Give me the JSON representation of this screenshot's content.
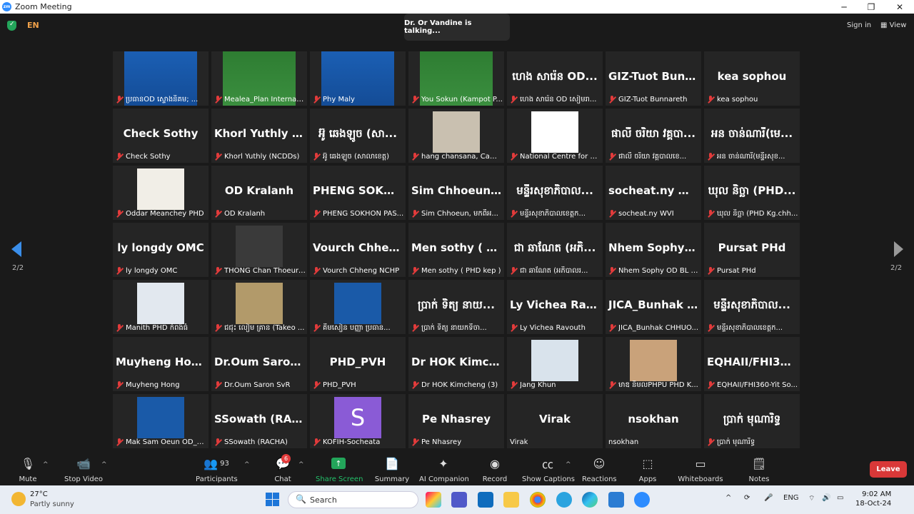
{
  "window": {
    "title": "Zoom Meeting",
    "minimize": "─",
    "maximize": "❐",
    "close": "✕"
  },
  "top": {
    "lang": "EN",
    "talking": "Dr. Or Vandine is talking...",
    "signin": "Sign in",
    "view": "View"
  },
  "pager": {
    "left": "2/2",
    "right": "2/2"
  },
  "tiles": [
    {
      "big": "",
      "label": "ប្រធានOD ស្ទោងនិគម; ..."
    },
    {
      "big": "",
      "label": "Mealea_Plan Internatio..."
    },
    {
      "big": "",
      "label": "Phy Maly"
    },
    {
      "big": "",
      "label": "You Sokun (Kampot P..."
    },
    {
      "big": "ហេង សារ៉េន OD...",
      "label": "ហេង សារ៉េន OD សៀមរា..."
    },
    {
      "big": "GIZ-Tuot Bunna...",
      "label": "GIZ-Tuot Bunnareth"
    },
    {
      "big": "kea sophou",
      "label": "kea sophou"
    },
    {
      "big": "Check Sothy",
      "label": "Check Sothy"
    },
    {
      "big": "Khorl Yuthly (N...",
      "label": "Khorl Yuthly (NCDDs)"
    },
    {
      "big": "អ៊ូ ឆេងឡូច (សា...",
      "label": "អ៊ូ ឆេងឡូច (សាលាខេត្ត)"
    },
    {
      "big": "",
      "label": "hang chansana, Camb..."
    },
    {
      "big": "",
      "label": "National Centre for Health..."
    },
    {
      "big": "ផាលី ចរិយា វគ្គបា...",
      "label": "ផាលី ចរិយា វគ្គបាលខេ..."
    },
    {
      "big": "អន ចាន់ណារី(មេ...",
      "label": "អន ចាន់ណារី(មន្ទីរសុខ..."
    },
    {
      "big": "",
      "label": "Oddar Meanchey PHD"
    },
    {
      "big": "OD Kralanh",
      "label": "OD Kralanh"
    },
    {
      "big": "PHENG SOKHO...",
      "label": "PHENG SOKHON PAS..."
    },
    {
      "big": "Sim Chhoeun, ម...",
      "label": "Sim Chhoeun, មកពីអ..."
    },
    {
      "big": "មន្ទីរសុខាភិបាល...",
      "label": "មន្ទីរសុខាភិបាលខេត្តក..."
    },
    {
      "big": "socheat.ny WVI",
      "label": "socheat.ny WVI"
    },
    {
      "big": "ឃុល និច្ឆា (PHD...",
      "label": "ឃុល និច្ឆា (PHD Kg.chh..."
    },
    {
      "big": "ly longdy    OMC",
      "label": "ly longdy    OMC"
    },
    {
      "big": "",
      "label": "THONG Chan Thoeurn..."
    },
    {
      "big": "Vourch Chheng...",
      "label": "Vourch Chheng NCHP"
    },
    {
      "big": "Men sothy ( PH...",
      "label": "Men sothy ( PHD kep )"
    },
    {
      "big": "ជា ឆាណែត (អភិ...",
      "label": "ជា ឆាណែត (អភិបាលរ..."
    },
    {
      "big": "Nhem Sophy O...",
      "label": "Nhem Sophy OD BL R..."
    },
    {
      "big": "Pursat PHd",
      "label": "Pursat PHd"
    },
    {
      "big": "",
      "label": "Manith PHD កំពង់ធំ"
    },
    {
      "big": "",
      "label": "ជជុះ លៀម គ្រាន (Takeo ..."
    },
    {
      "big": "",
      "label": "គីមសៀន បញ្ញា ប្រធាន..."
    },
    {
      "big": "ប្រាក់ ទិត្យ នាយ...",
      "label": "ប្រាក់ ទិត្យ នាយកទីចា..."
    },
    {
      "big": "Ly Vichea Ravou...",
      "label": "Ly Vichea Ravouth"
    },
    {
      "big": "JICA_Bunhak C...",
      "label": "JICA_Bunhak CHHUO..."
    },
    {
      "big": "មន្ទីរសុខាភិបាល...",
      "label": "មន្ទីរសុខាភិបាលខេត្តក..."
    },
    {
      "big": "Muyheng Hong",
      "label": "Muyheng Hong"
    },
    {
      "big": "Dr.Oum Saron S...",
      "label": "Dr.Oum Saron SvR"
    },
    {
      "big": "PHD_PVH",
      "label": "PHD_PVH"
    },
    {
      "big": "Dr HOK Kimche...",
      "label": "Dr HOK Kimcheng (3)"
    },
    {
      "big": "",
      "label": "Jang Khun"
    },
    {
      "big": "",
      "label": "មាឌ និមលPHPU PHD K..."
    },
    {
      "big": "EQHAII/FHI360-...",
      "label": "EQHAII/FHI360-Yit So..."
    },
    {
      "big": "",
      "label": "Mak Sam Oeun OD_A..."
    },
    {
      "big": "SSowath (RACHA)",
      "label": "SSowath (RACHA)"
    },
    {
      "big": "S",
      "label": "KOFIH-Socheata"
    },
    {
      "big": "Pe Nhasrey",
      "label": "Pe Nhasrey"
    },
    {
      "big": "Virak",
      "label": "Virak"
    },
    {
      "big": "nsokhan",
      "label": "nsokhan"
    },
    {
      "big": "ប្រាក់ មុណារិទ្ធ",
      "label": "ប្រាក់ មុណារិទ្ធ"
    }
  ],
  "toolbar": {
    "mute": "Mute",
    "stop_video": "Stop Video",
    "participants": "Participants",
    "participants_count": "93",
    "chat": "Chat",
    "chat_badge": "6",
    "share": "Share Screen",
    "summary": "Summary",
    "ai": "AI Companion",
    "record": "Record",
    "captions": "Show Captions",
    "reactions": "Reactions",
    "apps": "Apps",
    "whiteboards": "Whiteboards",
    "notes": "Notes",
    "leave": "Leave"
  },
  "taskbar": {
    "temp": "27°C",
    "weather": "Partly sunny",
    "search": "Search",
    "lang": "ENG",
    "time": "9:02 AM",
    "date": "18-Oct-24"
  }
}
